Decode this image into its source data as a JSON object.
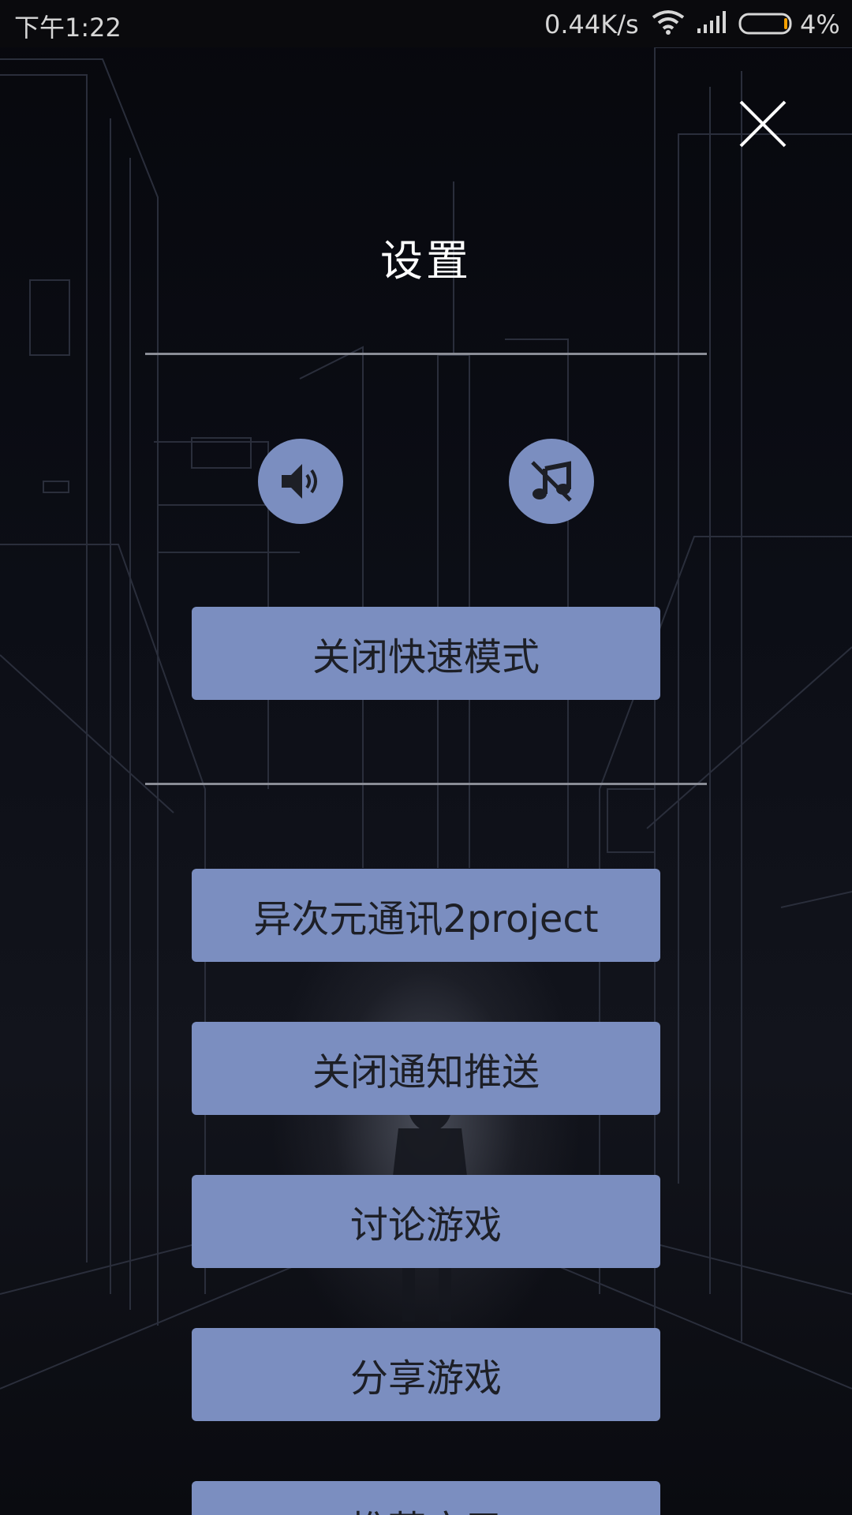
{
  "status_bar": {
    "time": "下午1:22",
    "speed": "0.44K/s",
    "battery": "4%",
    "icons": [
      "wifi-icon",
      "signal-icon",
      "battery-icon"
    ]
  },
  "header": {
    "title": "设置",
    "close_icon": "close-icon"
  },
  "toggles": {
    "sound": {
      "icon": "speaker-icon",
      "state": "on"
    },
    "music": {
      "icon": "music-off-icon",
      "state": "off"
    }
  },
  "buttons": {
    "fast_mode": "关闭快速模式",
    "project": "异次元通讯2project",
    "push": "关闭通知推送",
    "discuss": "讨论游戏",
    "share": "分享游戏",
    "recommend": "推荐应用"
  },
  "colors": {
    "accent": "#7b8ec0",
    "button_text": "#1d1f26",
    "title": "#ffffff"
  }
}
